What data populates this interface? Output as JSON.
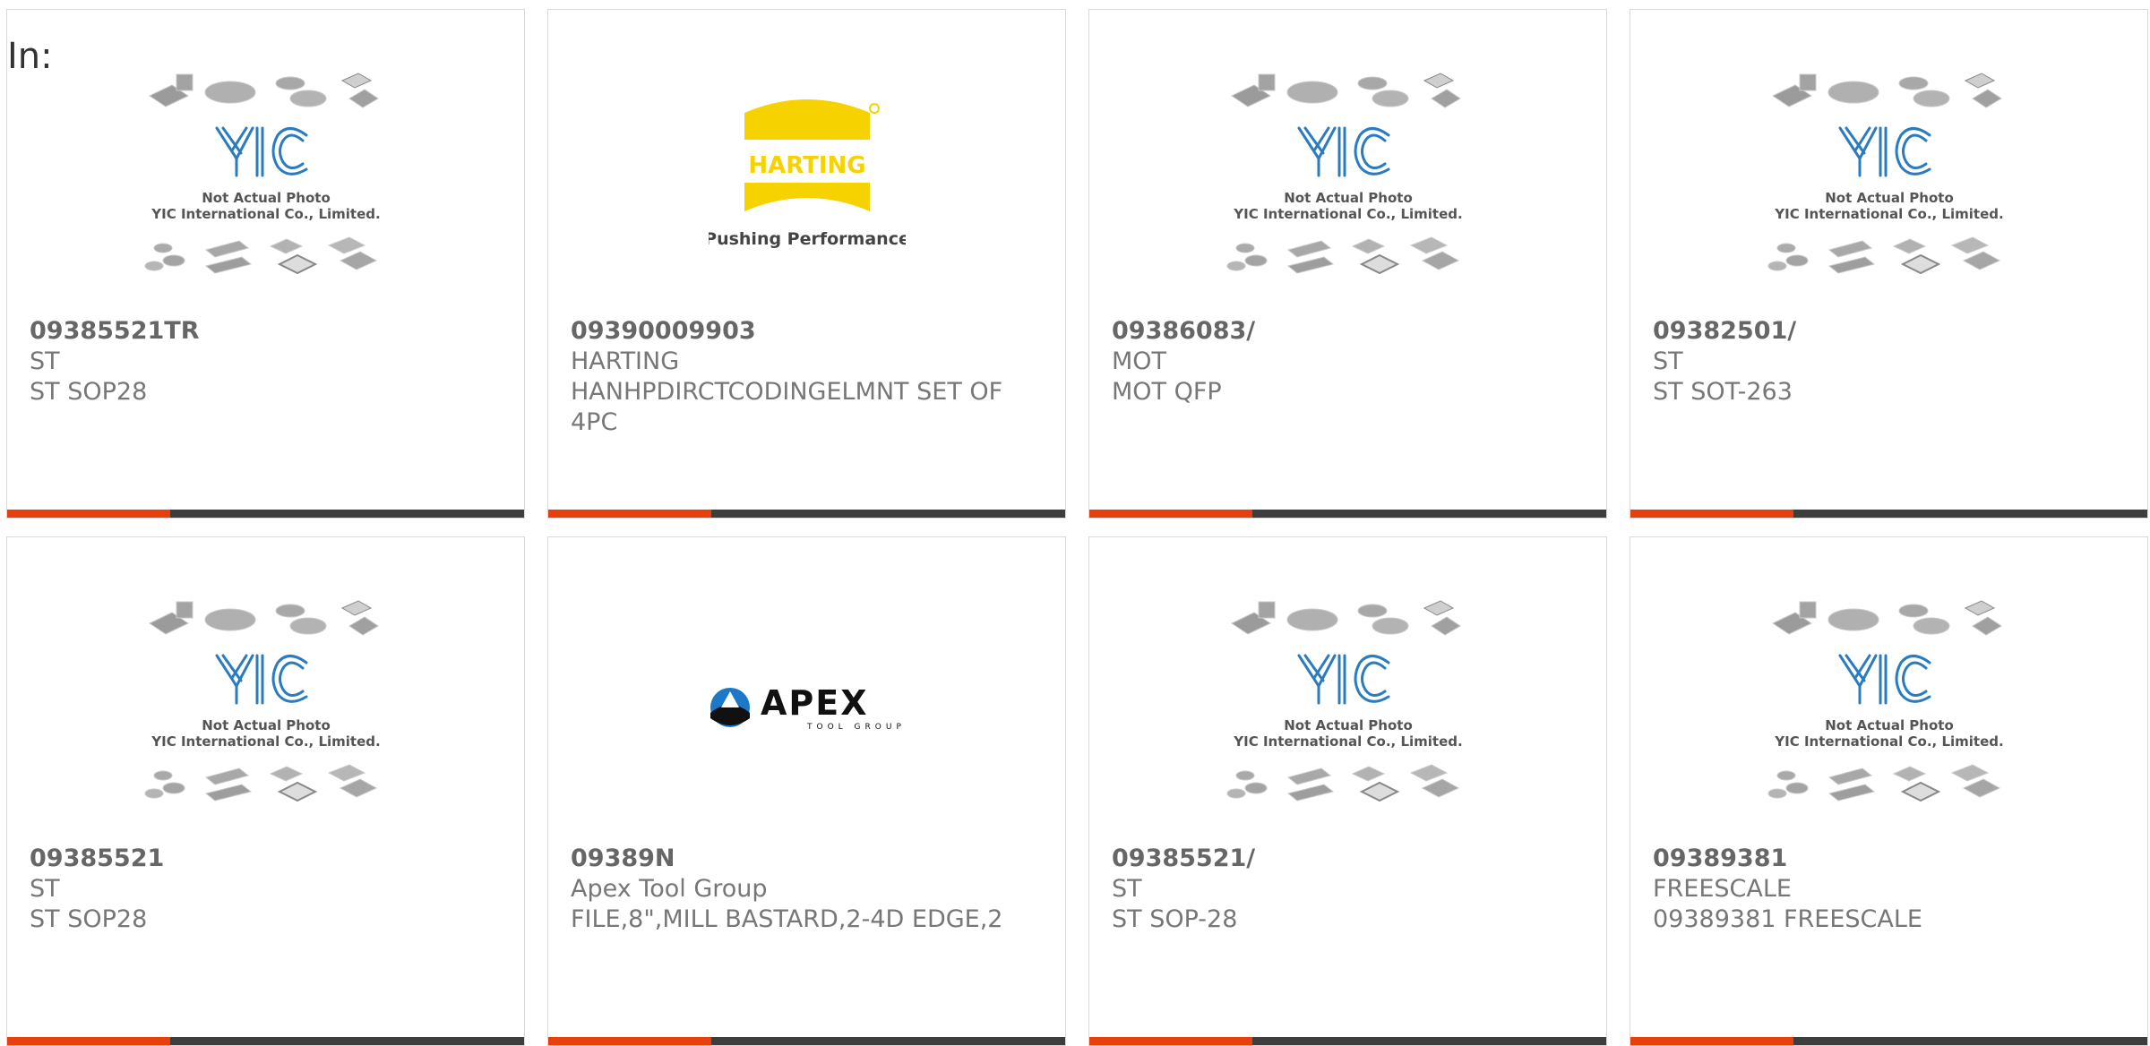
{
  "header": {
    "in_label": "In:"
  },
  "placeholder_image": {
    "line1": "Not Actual Photo",
    "line2": "YIC International Co., Limited.",
    "logo_text": "YIC"
  },
  "brand_logos": {
    "harting": {
      "name": "HARTING",
      "tagline": "Pushing Performance"
    },
    "apex": {
      "name": "APEX",
      "tagline": "TOOL GROUP"
    }
  },
  "colors": {
    "accent": "#e8400c",
    "bar": "#3d3d3d",
    "harting_yellow": "#f6d200",
    "yic_blue": "#2b7bc0"
  },
  "products": [
    {
      "part_number": "09385521TR",
      "manufacturer": "ST",
      "description": "ST SOP28",
      "image": "yic-placeholder"
    },
    {
      "part_number": "09390009903",
      "manufacturer": "HARTING",
      "description": "HANHPDIRCTCODINGELMNT SET OF 4PC",
      "image": "harting-logo"
    },
    {
      "part_number": "09386083/",
      "manufacturer": "MOT",
      "description": "MOT QFP",
      "image": "yic-placeholder"
    },
    {
      "part_number": "09382501/",
      "manufacturer": "ST",
      "description": "ST SOT-263",
      "image": "yic-placeholder"
    },
    {
      "part_number": "09385521",
      "manufacturer": "ST",
      "description": "ST SOP28",
      "image": "yic-placeholder"
    },
    {
      "part_number": "09389N",
      "manufacturer": "Apex Tool Group",
      "description": "FILE,8\",MILL BASTARD,2-4D EDGE,2",
      "image": "apex-logo"
    },
    {
      "part_number": "09385521/",
      "manufacturer": "ST",
      "description": "ST SOP-28",
      "image": "yic-placeholder"
    },
    {
      "part_number": "09389381",
      "manufacturer": "FREESCALE",
      "description": "09389381 FREESCALE",
      "image": "yic-placeholder"
    }
  ]
}
